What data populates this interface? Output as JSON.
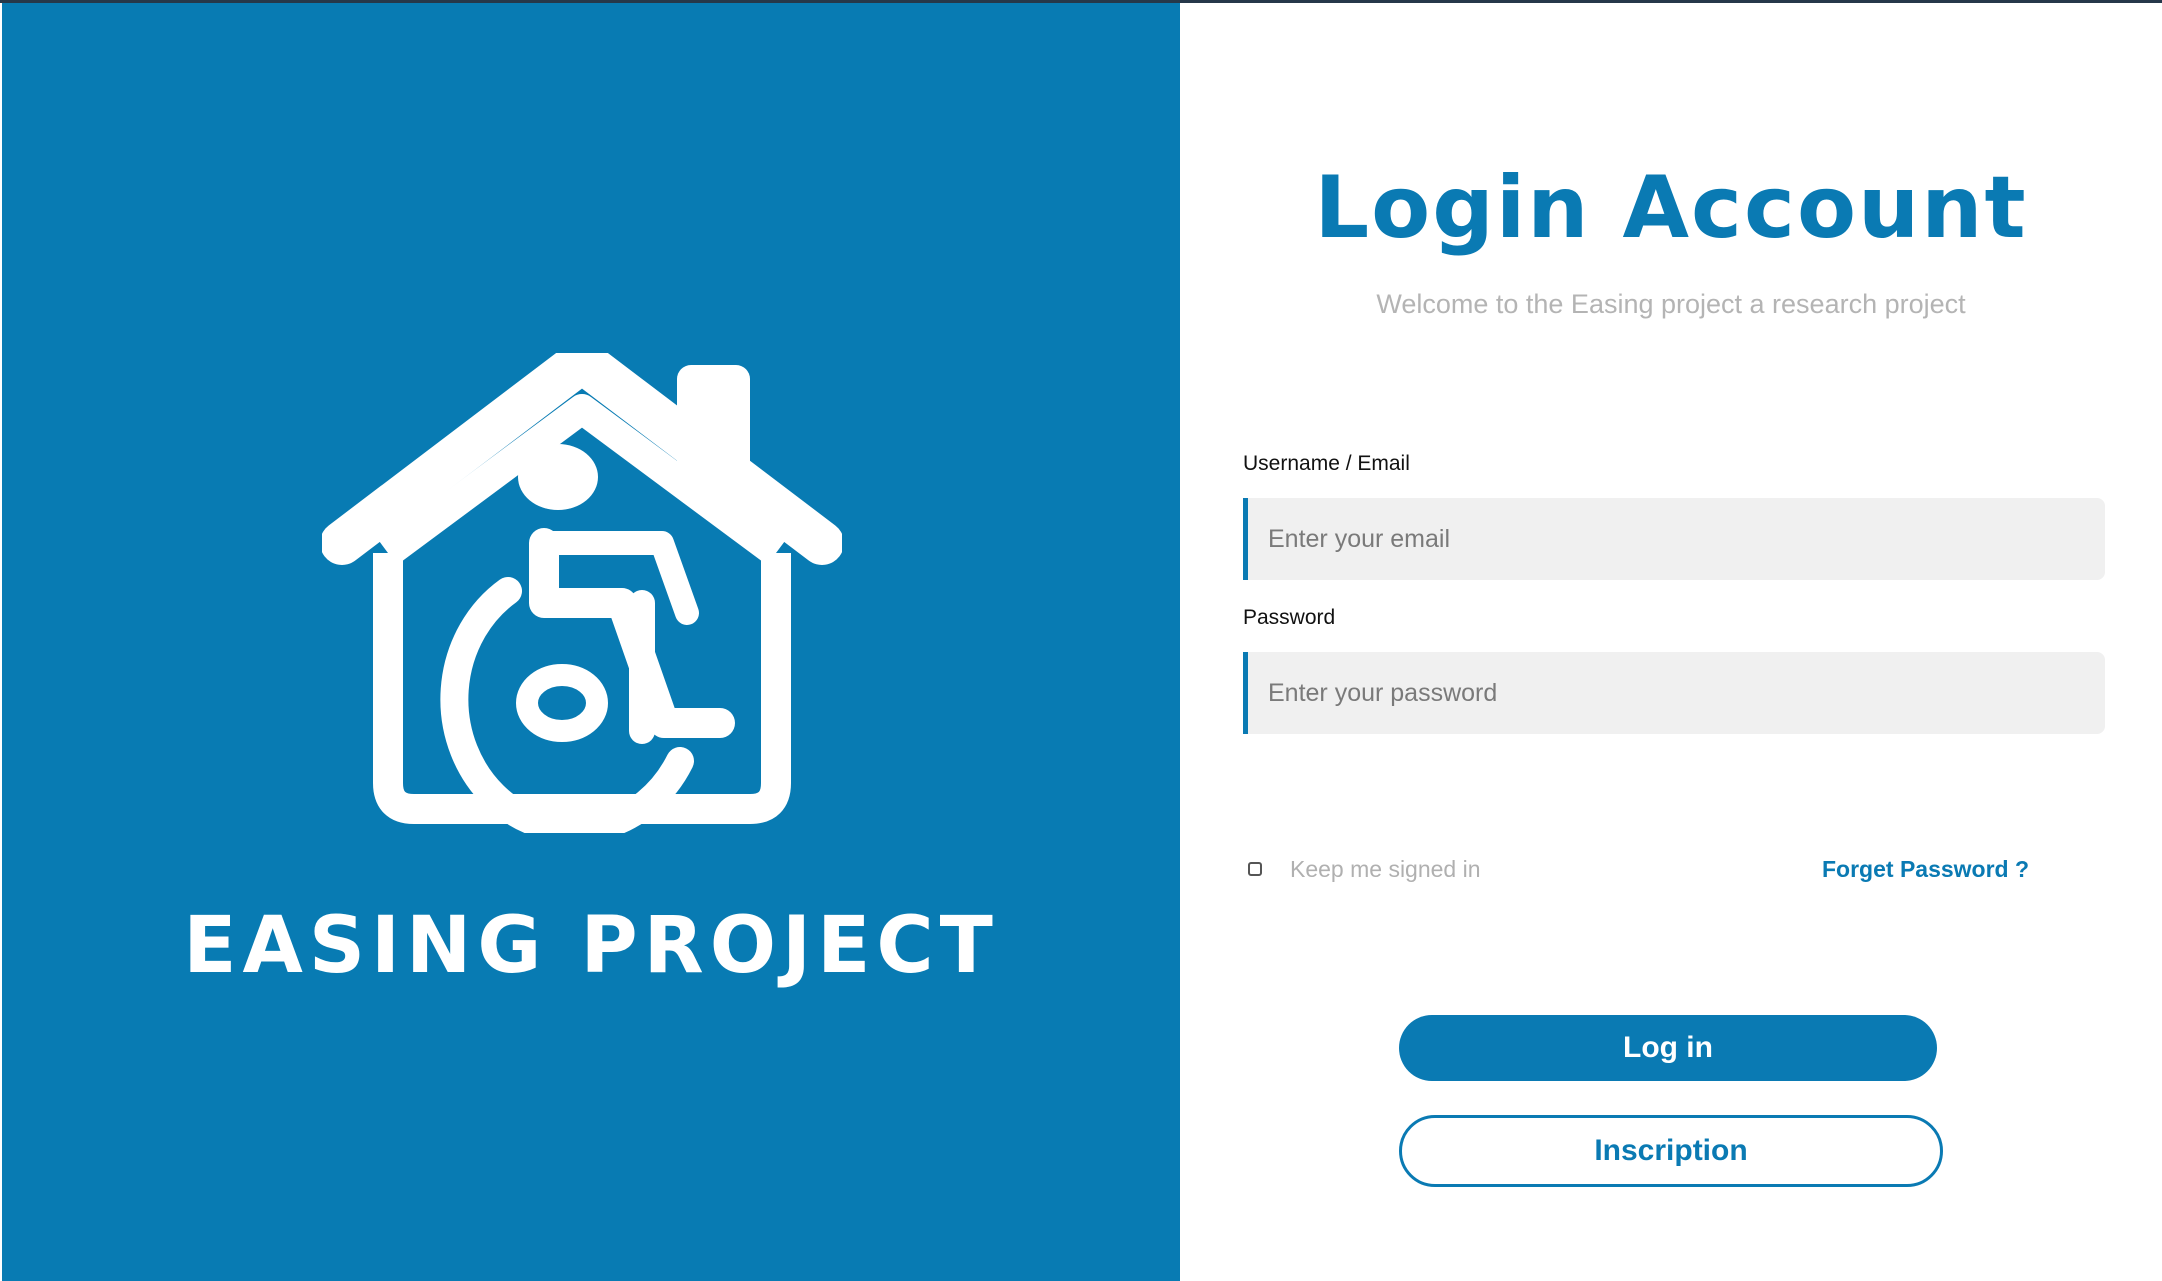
{
  "brand": {
    "name": "EASING PROJECT",
    "logo_icon": "house-wheelchair-icon",
    "panel_color": "#087bb3"
  },
  "login": {
    "title": "Login Account",
    "subtitle": "Welcome to the Easing project a research project",
    "email_label": "Username / Email",
    "email_placeholder": "Enter your email",
    "password_label": "Password",
    "password_placeholder": "Enter your password",
    "remember_label": "Keep me signed in",
    "remember_checked": false,
    "forget_label": "Forget Password ?",
    "login_button": "Log in",
    "signup_button": "Inscription",
    "accent_color": "#0a7ab3"
  }
}
